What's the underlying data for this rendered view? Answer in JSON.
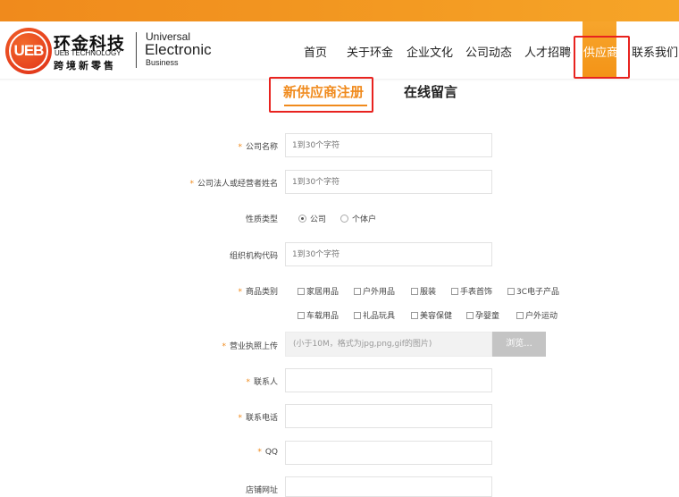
{
  "logo": {
    "mark": "UEB",
    "cn_name": "环金科技",
    "en_name": "UEB TECHNOLOGY",
    "slogan": "跨境新零售",
    "line1": "Universal",
    "line2": "Electronic",
    "line3": "Business"
  },
  "nav": {
    "items": [
      "首页",
      "关于环金",
      "企业文化",
      "公司动态",
      "人才招聘",
      "供应商",
      "联系我们"
    ],
    "active_index": 5
  },
  "tabs": {
    "active": "新供应商注册",
    "inactive": "在线留言"
  },
  "form": {
    "required_mark": "*",
    "company_name": {
      "label": "公司名称",
      "placeholder": "1到30个字符"
    },
    "legal_person": {
      "label": "公司法人或经营者姓名",
      "placeholder": "1到30个字符"
    },
    "nature": {
      "label": "性质类型",
      "options": [
        "公司",
        "个体户"
      ],
      "selected": "公司"
    },
    "org_code": {
      "label": "组织机构代码",
      "placeholder": "1到30个字符"
    },
    "category": {
      "label": "商品类别",
      "options_row1": [
        "家居用品",
        "户外用品",
        "服装",
        "手表首饰",
        "3C电子产品"
      ],
      "options_row2": [
        "车载用品",
        "礼品玩具",
        "美容保健",
        "孕婴童",
        "户外运动"
      ]
    },
    "license": {
      "label": "营业执照上传",
      "hint": "(小于10M，格式为jpg,png,gif的图片)",
      "browse_label": "浏览..."
    },
    "contact": {
      "label": "联系人"
    },
    "phone": {
      "label": "联系电话"
    },
    "qq": {
      "label": "QQ"
    },
    "shop_url": {
      "label": "店铺网址"
    }
  },
  "colors": {
    "accent": "#f08a1c",
    "highlight_border": "#e8231f",
    "logo_red": "#e53c1c"
  }
}
